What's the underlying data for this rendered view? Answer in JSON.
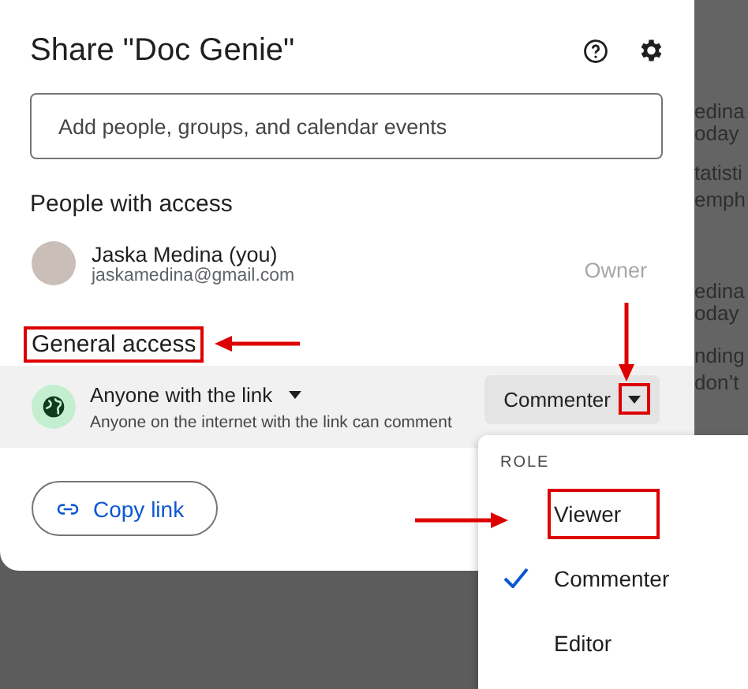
{
  "dialog": {
    "title": "Share \"Doc Genie\"",
    "search": {
      "placeholder": "Add people, groups, and calendar events"
    },
    "people_heading": "People with access",
    "people": [
      {
        "name": "Jaska Medina (you)",
        "email": "jaskamedina@gmail.com",
        "role": "Owner"
      }
    ],
    "general_access": {
      "heading": "General access",
      "heading_highlighted": true,
      "scope": "Anyone with the link",
      "description": "Anyone on the internet with the link can comment",
      "role": "Commenter",
      "caret_highlighted": true
    },
    "copy_link": "Copy link"
  },
  "role_menu": {
    "heading": "ROLE",
    "items": [
      {
        "label": "Viewer",
        "selected": false,
        "highlighted": true
      },
      {
        "label": "Commenter",
        "selected": true,
        "highlighted": false
      },
      {
        "label": "Editor",
        "selected": false,
        "highlighted": false
      }
    ]
  },
  "background_text": [
    "edina",
    "oday",
    "tatisti",
    "emph",
    "edina",
    "oday",
    "nding",
    "don’t"
  ]
}
